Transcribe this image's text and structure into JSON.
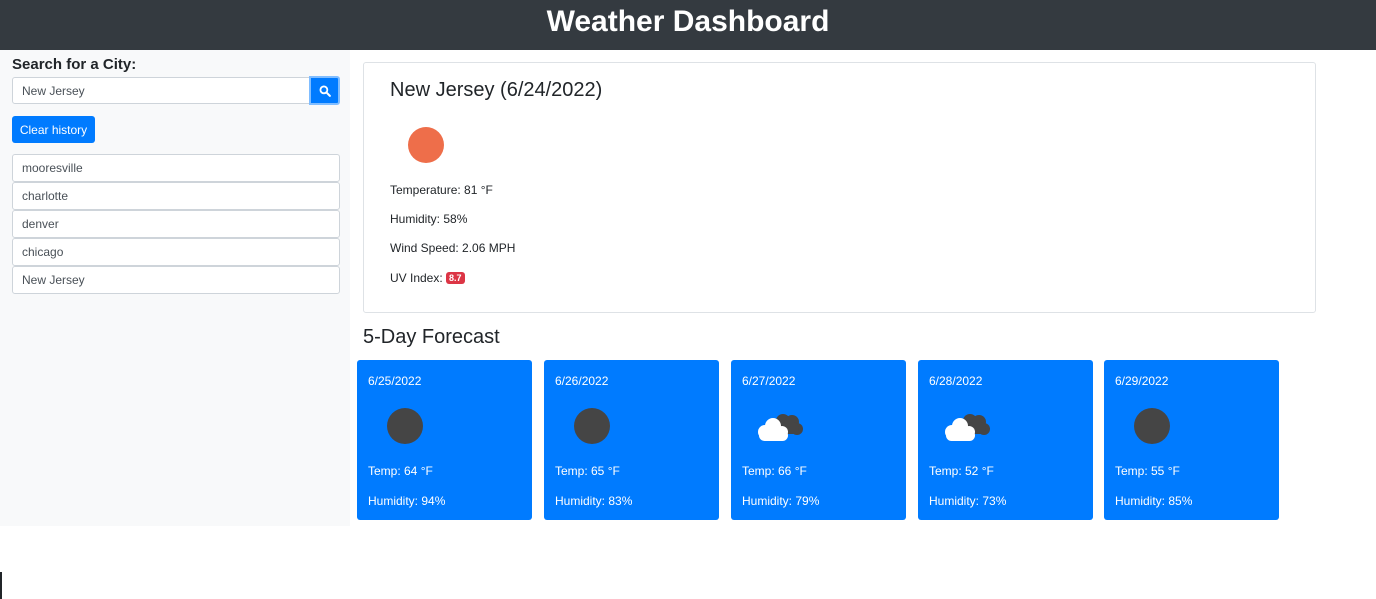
{
  "header": {
    "title": "Weather Dashboard"
  },
  "sidebar": {
    "search_label": "Search for a City:",
    "search_value": "New Jersey",
    "search_icon": "search-icon",
    "clear_label": "Clear history",
    "history": [
      "mooresville",
      "charlotte",
      "denver",
      "chicago",
      "New Jersey"
    ]
  },
  "current": {
    "title": "New Jersey (6/24/2022)",
    "icon": "clear-sun-icon",
    "icon_color": "#ee6e4a",
    "temperature": "Temperature: 81 °F",
    "humidity": "Humidity: 58%",
    "wind": "Wind Speed: 2.06 MPH",
    "uv_label": "UV Index:",
    "uv_value": "8.7",
    "uv_color": "#dc3545"
  },
  "forecast": {
    "title": "5-Day Forecast",
    "days": [
      {
        "date": "6/25/2022",
        "icon": "dark-cloud-icon",
        "temp": "Temp: 64 °F",
        "humidity": "Humidity: 94%"
      },
      {
        "date": "6/26/2022",
        "icon": "dark-cloud-icon",
        "temp": "Temp: 65 °F",
        "humidity": "Humidity: 83%"
      },
      {
        "date": "6/27/2022",
        "icon": "broken-clouds-icon",
        "temp": "Temp: 66 °F",
        "humidity": "Humidity: 79%"
      },
      {
        "date": "6/28/2022",
        "icon": "broken-clouds-icon",
        "temp": "Temp: 52 °F",
        "humidity": "Humidity: 73%"
      },
      {
        "date": "6/29/2022",
        "icon": "dark-cloud-icon",
        "temp": "Temp: 55 °F",
        "humidity": "Humidity: 85%"
      }
    ]
  },
  "colors": {
    "primary": "#007bff",
    "header_bg": "#343a40",
    "sidebar_bg": "#f8f9fa"
  }
}
